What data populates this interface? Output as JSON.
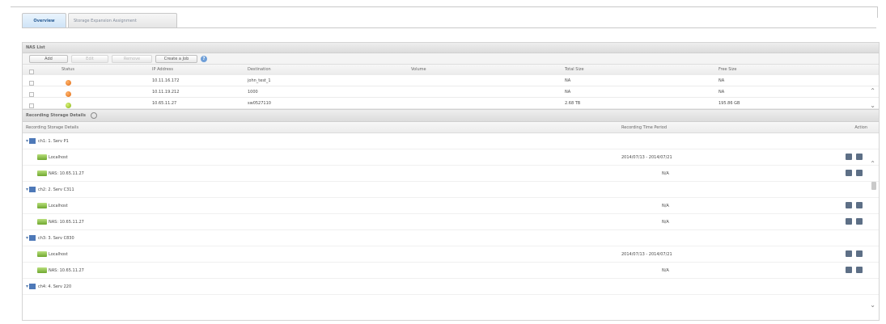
{
  "tabs": [
    {
      "label": "Overview",
      "active": true
    },
    {
      "label": "Storage Expansion Assignment",
      "active": false
    }
  ],
  "nas_list": {
    "title": "NAS List",
    "toolbar": {
      "add": "Add",
      "edit": "Edit",
      "remove": "Remove",
      "create_job": "Create a Job"
    },
    "columns": [
      "Status",
      "IP Address",
      "Destination",
      "Volume",
      "Total Size",
      "Free Size"
    ],
    "rows": [
      {
        "status": "error",
        "ip": "10.11.16.172",
        "destination": "john_test_1",
        "volume": "",
        "total": "NA",
        "free": "NA"
      },
      {
        "status": "error",
        "ip": "10.11.19.212",
        "destination": "1000",
        "volume": "",
        "total": "NA",
        "free": "NA"
      },
      {
        "status": "ok",
        "ip": "10.65.11.27",
        "destination": "sw0527110",
        "volume": "",
        "total": "2.68 TB",
        "free": "195.86 GB"
      }
    ]
  },
  "recording": {
    "title": "Recording Storage Details",
    "columns": [
      "Recording Storage Details",
      "Recording Time Period",
      "Action"
    ],
    "rows": [
      {
        "type": "channel",
        "label": "ch1: 1. Serv P1",
        "period": ""
      },
      {
        "type": "storage",
        "label": "Localhost",
        "period": "2014/07/13 - 2014/07/21"
      },
      {
        "type": "storage",
        "label": "NAS: 10.65.11.27",
        "period": "N/A"
      },
      {
        "type": "channel",
        "label": "ch2: 2. Serv C311",
        "period": ""
      },
      {
        "type": "storage",
        "label": "Localhost",
        "period": "N/A"
      },
      {
        "type": "storage",
        "label": "NAS: 10.65.11.27",
        "period": "N/A"
      },
      {
        "type": "channel",
        "label": "ch3: 3. Serv C830",
        "period": ""
      },
      {
        "type": "storage",
        "label": "Localhost",
        "period": "2014/07/13 - 2014/07/21"
      },
      {
        "type": "storage",
        "label": "NAS: 10.65.11.27",
        "period": "N/A"
      },
      {
        "type": "channel",
        "label": "ch4: 4. Serv 220",
        "period": ""
      }
    ]
  }
}
